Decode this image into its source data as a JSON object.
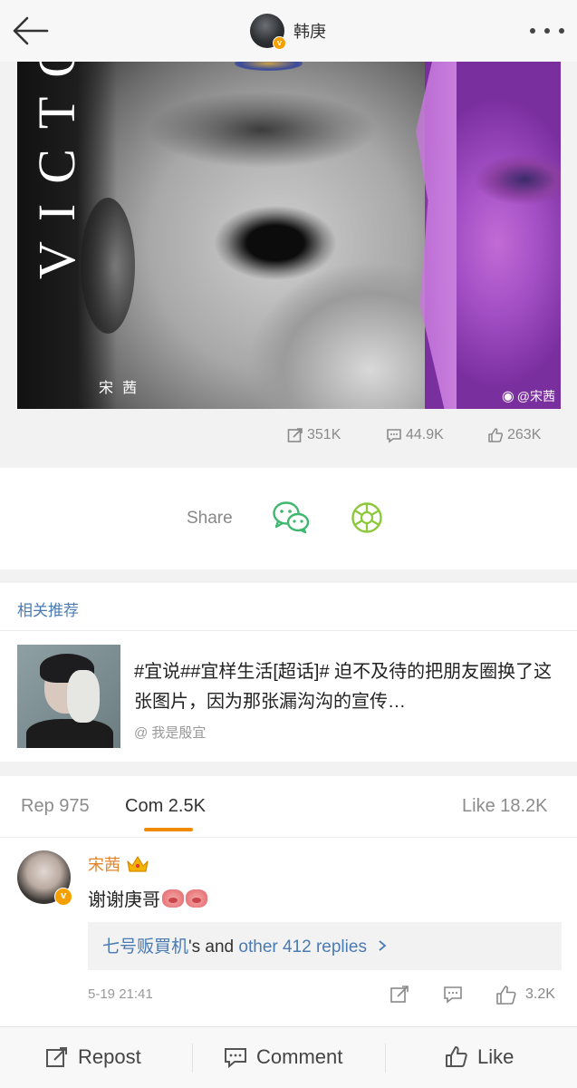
{
  "header": {
    "username": "韩庚",
    "verified_badge": "v"
  },
  "post": {
    "image_title_text": "VICTO",
    "image_caption_name": "宋茜",
    "watermark": "@宋茜",
    "stats": {
      "reposts": "351K",
      "comments": "44.9K",
      "likes": "263K"
    }
  },
  "share": {
    "label": "Share",
    "icons": [
      "wechat-icon",
      "moments-icon"
    ]
  },
  "recommend": {
    "title": "相关推荐",
    "item": {
      "text": "#宜说##宜样生活[超话]# 迫不及待的把朋友圈换了这张图片，因为那张漏沟沟的宣传…",
      "author": "@ 我是殷宜"
    }
  },
  "tabs": {
    "reposts": "Rep 975",
    "comments": "Com 2.5K",
    "likes": "Like 18.2K",
    "active": "comments"
  },
  "comment": {
    "name": "宋茜",
    "text": "谢谢庚哥",
    "replies_user": "七号贩買机",
    "replies_mid": "'s and ",
    "replies_more": "other 412 replies",
    "time": "5-19 21:41",
    "like_count": "3.2K"
  },
  "bottombar": {
    "repost": "Repost",
    "comment": "Comment",
    "like": "Like"
  },
  "colors": {
    "accent_orange": "#f08a00",
    "link_blue": "#4a7bb3",
    "wechat_green": "#3fb76e",
    "moments_green": "#8cc83a"
  }
}
